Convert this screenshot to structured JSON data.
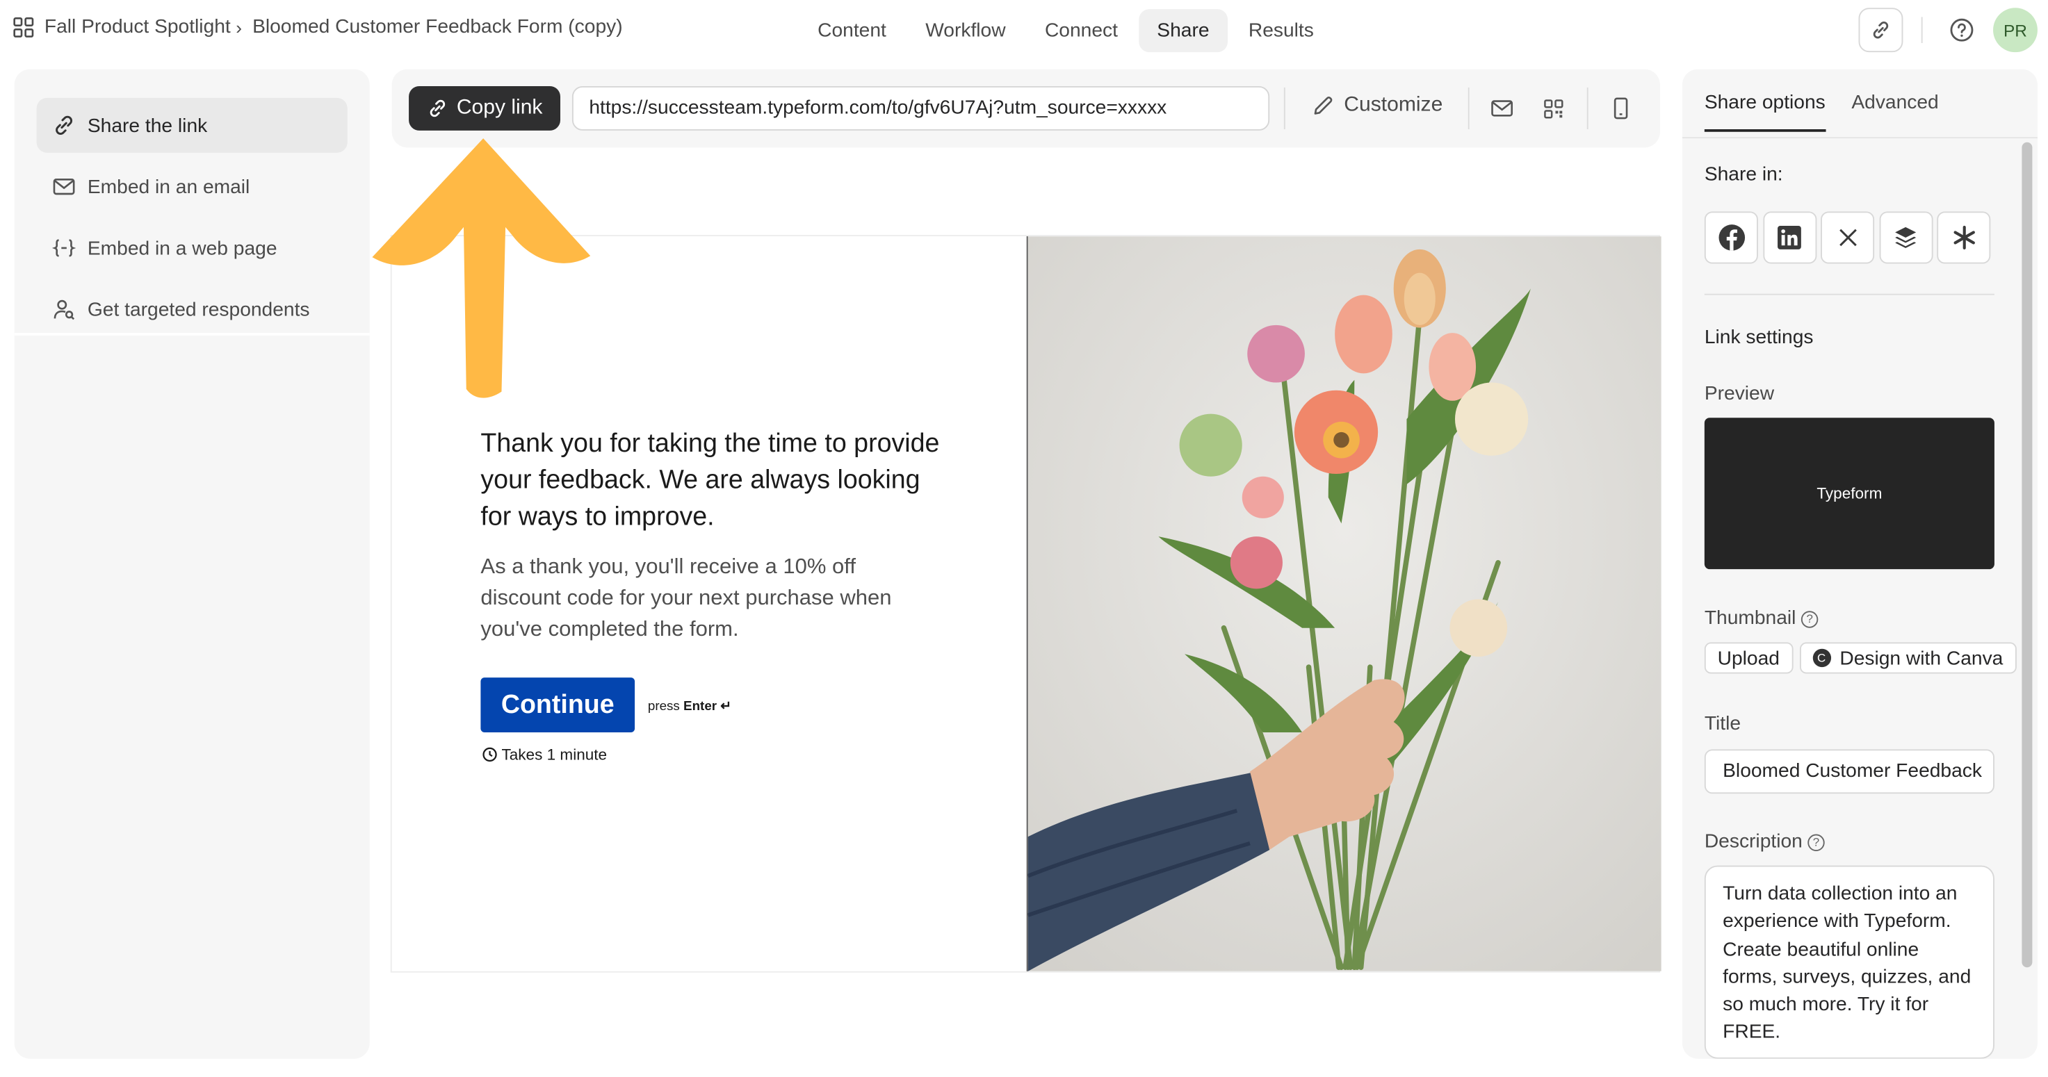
{
  "breadcrumb": {
    "workspace": "Fall Product Spotlight",
    "separator": "›",
    "form": "Bloomed Customer Feedback Form (copy)"
  },
  "nav_tabs": [
    {
      "label": "Content",
      "active": false
    },
    {
      "label": "Workflow",
      "active": false
    },
    {
      "label": "Connect",
      "active": false
    },
    {
      "label": "Share",
      "active": true
    },
    {
      "label": "Results",
      "active": false
    }
  ],
  "user": {
    "initials": "PR"
  },
  "sidebar": {
    "items": [
      {
        "label": "Share the link",
        "icon": "link-icon",
        "active": true
      },
      {
        "label": "Embed in an email",
        "icon": "mail-icon",
        "active": false
      },
      {
        "label": "Embed in a web page",
        "icon": "code-braces-icon",
        "active": false
      },
      {
        "label": "Get targeted respondents",
        "icon": "person-search-icon",
        "active": false
      }
    ]
  },
  "share_bar": {
    "copy_label": "Copy link",
    "url": "https://successteam.typeform.com/to/gfv6U7Aj?utm_source=xxxxx",
    "customize_label": "Customize"
  },
  "form_preview": {
    "title": "Thank you for taking the time to provide your feedback. We are always looking for ways to improve.",
    "subtitle": "As a thank you, you'll receive a 10% off discount code for your next purchase when you've completed the form.",
    "button_label": "Continue",
    "press_text": "press",
    "press_key": "Enter ↵",
    "duration": "Takes 1 minute"
  },
  "right_panel": {
    "tabs": [
      {
        "label": "Share options",
        "active": true
      },
      {
        "label": "Advanced",
        "active": false
      }
    ],
    "share_in_label": "Share in:",
    "social": [
      "facebook-icon",
      "linkedin-icon",
      "x-icon",
      "buffer-icon",
      "asterisk-icon"
    ],
    "link_settings_label": "Link settings",
    "preview_label": "Preview",
    "preview_card_text": "Typeform",
    "thumbnail_label": "Thumbnail",
    "upload_label": "Upload",
    "canva_label": "Design with Canva",
    "title_label": "Title",
    "title_value": "Bloomed Customer Feedback",
    "description_label": "Description",
    "description_value": "Turn data collection into an experience with Typeform. Create beautiful online forms, surveys, quizzes, and so much more. Try it for FREE."
  },
  "colors": {
    "accent_dark": "#2f2f30",
    "continue_blue": "#0445af",
    "annotation_arrow": "#ffb945",
    "avatar_bg": "#c9e8c3"
  }
}
